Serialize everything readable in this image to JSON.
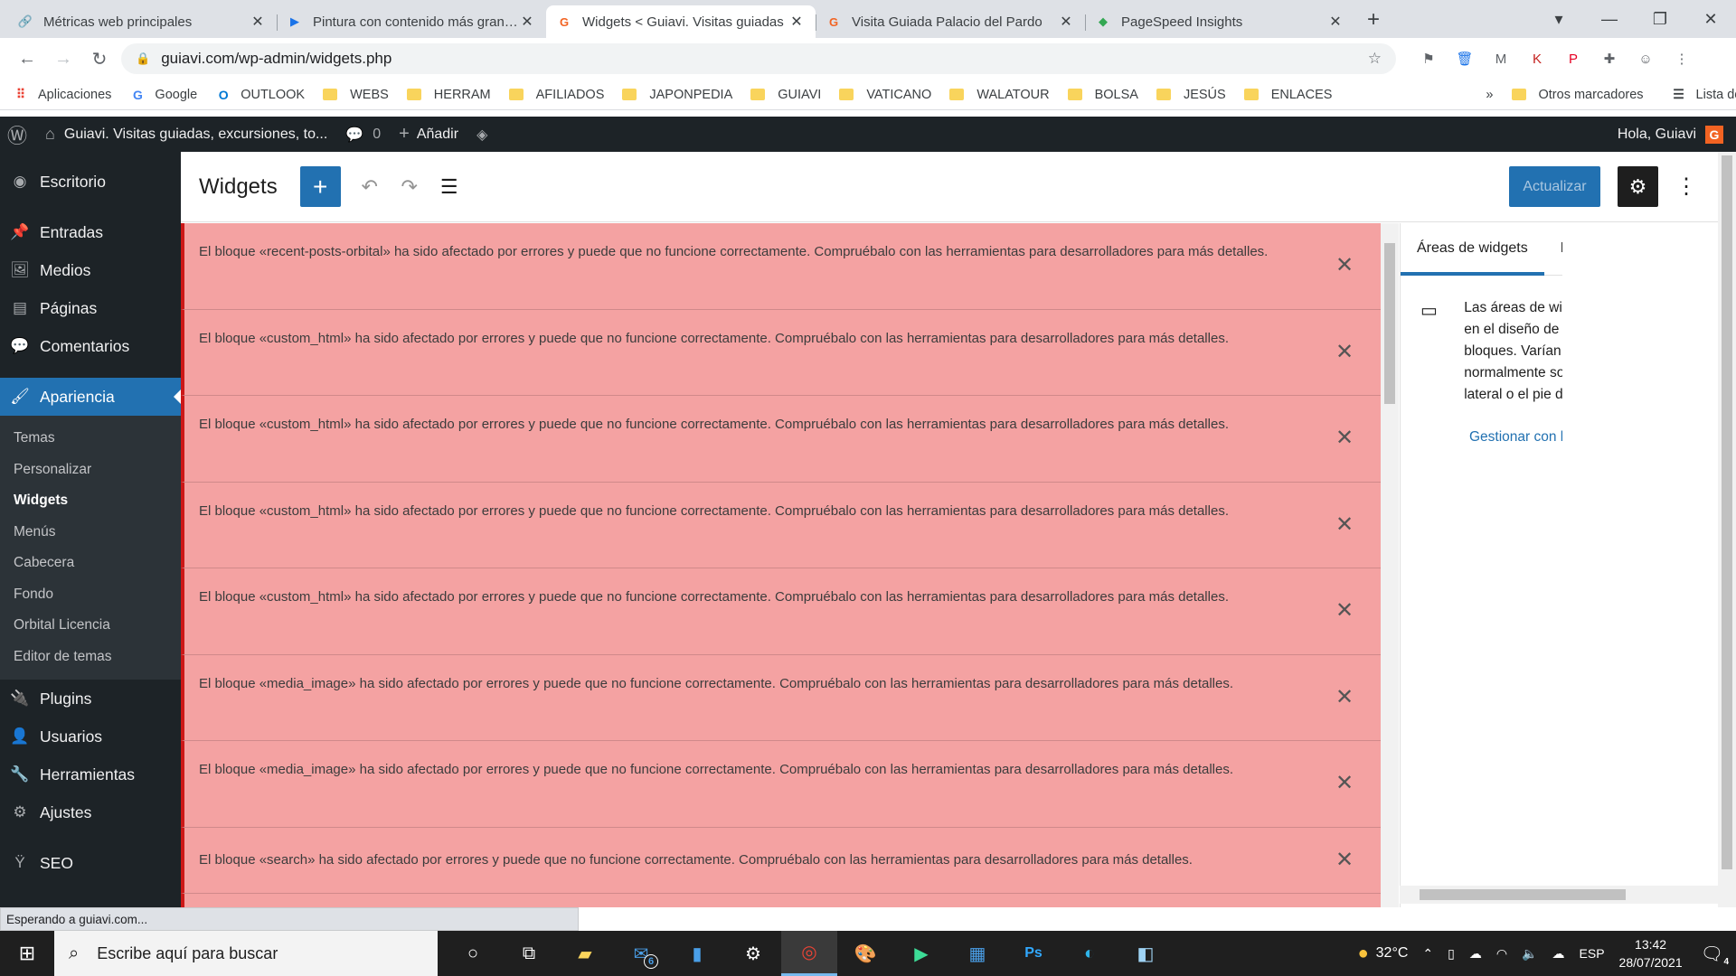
{
  "browser": {
    "tabs": [
      {
        "title": "Métricas web principales",
        "icon": "🔗"
      },
      {
        "title": "Pintura con contenido más grande",
        "icon": "▶"
      },
      {
        "title": "Widgets < Guiavi. Visitas guiadas",
        "icon": "G"
      },
      {
        "title": "Visita Guiada Palacio del Pardo",
        "icon": "G"
      },
      {
        "title": "PageSpeed Insights",
        "icon": "◆"
      }
    ],
    "url": "guiavi.com/wp-admin/widgets.php",
    "bookmarks": [
      "Aplicaciones",
      "Google",
      "OUTLOOK",
      "WEBS",
      "HERRAM",
      "AFILIADOS",
      "JAPONPEDIA",
      "GUIAVI",
      "VATICANO",
      "WALATOUR",
      "BOLSA",
      "JESÚS",
      "ENLACES"
    ],
    "bookmarks_more": "»",
    "other_bookmarks": "Otros marcadores",
    "reading_list": "Lista de lectura"
  },
  "adminbar": {
    "site": "Guiavi. Visitas guiadas, excursiones, to...",
    "comments": "0",
    "add": "Añadir",
    "greeting": "Hola, Guiavi"
  },
  "sidebar": {
    "items_top": [
      {
        "label": "Escritorio",
        "icon": "◉"
      }
    ],
    "items_mid": [
      {
        "label": "Entradas",
        "icon": "📌"
      },
      {
        "label": "Medios",
        "icon": "🖼"
      },
      {
        "label": "Páginas",
        "icon": "▤"
      },
      {
        "label": "Comentarios",
        "icon": "💬"
      }
    ],
    "active": {
      "label": "Apariencia",
      "icon": "🖌"
    },
    "sub": [
      "Temas",
      "Personalizar",
      "Widgets",
      "Menús",
      "Cabecera",
      "Fondo",
      "Orbital Licencia",
      "Editor de temas"
    ],
    "items_bottom": [
      {
        "label": "Plugins",
        "icon": "🔌"
      },
      {
        "label": "Usuarios",
        "icon": "👤"
      },
      {
        "label": "Herramientas",
        "icon": "🔧"
      },
      {
        "label": "Ajustes",
        "icon": "⚙"
      }
    ],
    "seo": {
      "label": "SEO",
      "icon": "Ÿ"
    }
  },
  "editor": {
    "title": "Widgets",
    "update_label": "Actualizar"
  },
  "notices": [
    "El bloque «recent-posts-orbital» ha sido afectado por errores y puede que no funcione correctamente. Compruébalo con las herramientas para desarrolladores para más detalles.",
    "El bloque «custom_html» ha sido afectado por errores y puede que no funcione correctamente. Compruébalo con las herramientas para desarrolladores para más detalles.",
    "El bloque «custom_html» ha sido afectado por errores y puede que no funcione correctamente. Compruébalo con las herramientas para desarrolladores para más detalles.",
    "El bloque «custom_html» ha sido afectado por errores y puede que no funcione correctamente. Compruébalo con las herramientas para desarrolladores para más detalles.",
    "El bloque «custom_html» ha sido afectado por errores y puede que no funcione correctamente. Compruébalo con las herramientas para desarrolladores para más detalles.",
    "El bloque «media_image» ha sido afectado por errores y puede que no funcione correctamente. Compruébalo con las herramientas para desarrolladores para más detalles.",
    "El bloque «media_image» ha sido afectado por errores y puede que no funcione correctamente. Compruébalo con las herramientas para desarrolladores para más detalles.",
    "El bloque «search» ha sido afectado por errores y puede que no funcione correctamente. Compruébalo con las herramientas para desarrolladores para más detalles."
  ],
  "panel": {
    "tab_areas": "Áreas de widgets",
    "tab_block": "Bloque",
    "description": "Las áreas de widgets son partes globales en el diseño de tu sitio que puedan aceptar bloques. Varían según el tema, pero normalmente son partes como tu barra lateral o el pie de página.",
    "link": "Gestionar con la vista previa en directo"
  },
  "status": "Esperando a guiavi.com...",
  "taskbar": {
    "search_placeholder": "Escribe aquí para buscar",
    "mail_badge": "6",
    "weather": "32°C",
    "lang": "ESP",
    "time": "13:42",
    "date": "28/07/2021",
    "notif": "4"
  },
  "colors": {
    "accent": "#2271b1",
    "error_bg": "#f4a2a2",
    "error_border": "#cc1818",
    "admin_dark": "#1d2327"
  }
}
